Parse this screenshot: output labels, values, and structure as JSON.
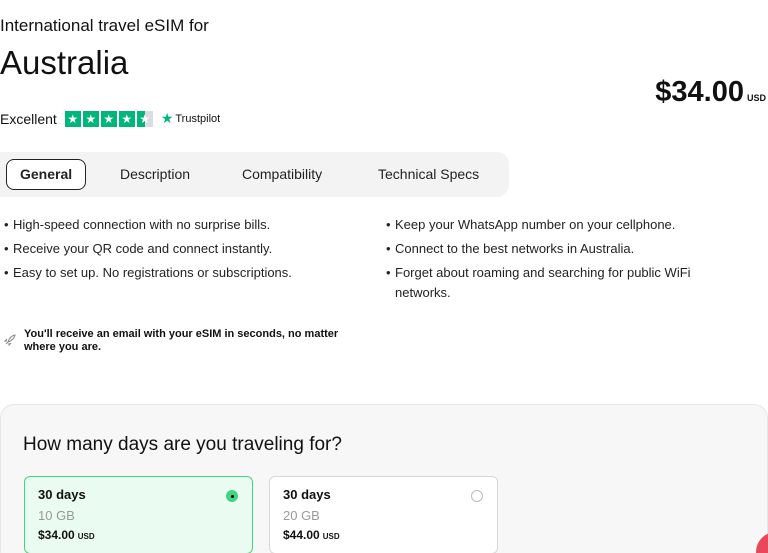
{
  "header": {
    "subtitle": "International travel eSIM for",
    "title": "Australia"
  },
  "price": {
    "amount": "$34.00",
    "currency": "USD"
  },
  "rating": {
    "label": "Excellent",
    "provider": "Trustpilot",
    "stars": 4.5
  },
  "tabs": [
    {
      "label": "General",
      "active": true
    },
    {
      "label": "Description",
      "active": false
    },
    {
      "label": "Compatibility",
      "active": false
    },
    {
      "label": "Technical Specs",
      "active": false
    }
  ],
  "features_left": [
    "High-speed connection with no surprise bills.",
    "Receive your QR code and connect instantly.",
    "Easy to set up. No registrations or subscriptions."
  ],
  "features_right": [
    "Keep your WhatsApp number on your cellphone.",
    "Connect to the best networks in Australia.",
    "Forget about roaming and searching for public WiFi networks."
  ],
  "notice": {
    "icon": "rocket-icon",
    "text": "You'll receive an email with your eSIM in seconds, no matter where you are."
  },
  "plans_section": {
    "question": "How many days are you traveling for?",
    "plans": [
      {
        "days": "30 days",
        "data": "10 GB",
        "price": "$34.00",
        "currency": "USD",
        "selected": true
      },
      {
        "days": "30 days",
        "data": "20 GB",
        "price": "$44.00",
        "currency": "USD",
        "selected": false
      }
    ]
  },
  "colors": {
    "accent": "#43d47f",
    "trustpilot": "#00b67a",
    "selected_bg": "#eafcf1"
  }
}
